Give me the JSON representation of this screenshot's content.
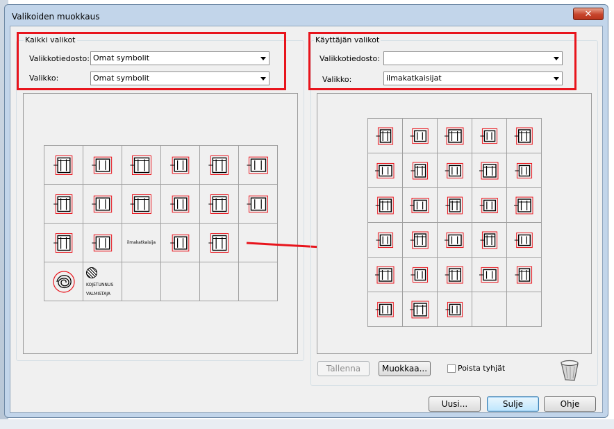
{
  "window": {
    "title": "Valikoiden muokkaus",
    "close_glyph": "✕"
  },
  "left_group": {
    "legend": "Kaikki valikot",
    "menu_file_label": "Valikkotiedosto:",
    "menu_file_value": "Omat symbolit",
    "menu_label": "Valikko:",
    "menu_value": "Omat symbolit",
    "cell_texts": [
      "ilmakatkaisija",
      "KOJETUNNUS",
      "VALMISTAJA"
    ]
  },
  "right_group": {
    "legend": "Käyttäjän valikot",
    "menu_file_label": "Valikkotiedosto:",
    "menu_file_value": "",
    "menu_label": "Valikko:",
    "menu_value": "ilmakatkaisijat",
    "save_label": "Tallenna",
    "edit_label": "Muokkaa...",
    "remove_empty_label": "Poista tyhjät"
  },
  "footer": {
    "new_label": "Uusi...",
    "close_label": "Sulje",
    "help_label": "Ohje"
  },
  "icons": {
    "trash": "trash-icon",
    "dropdown": "chevron-down-icon",
    "symbol": "breaker-symbol-icon"
  },
  "colors": {
    "highlight": "#e8141c",
    "symbol_line": "#e8141c",
    "symbol_body": "#000000"
  }
}
